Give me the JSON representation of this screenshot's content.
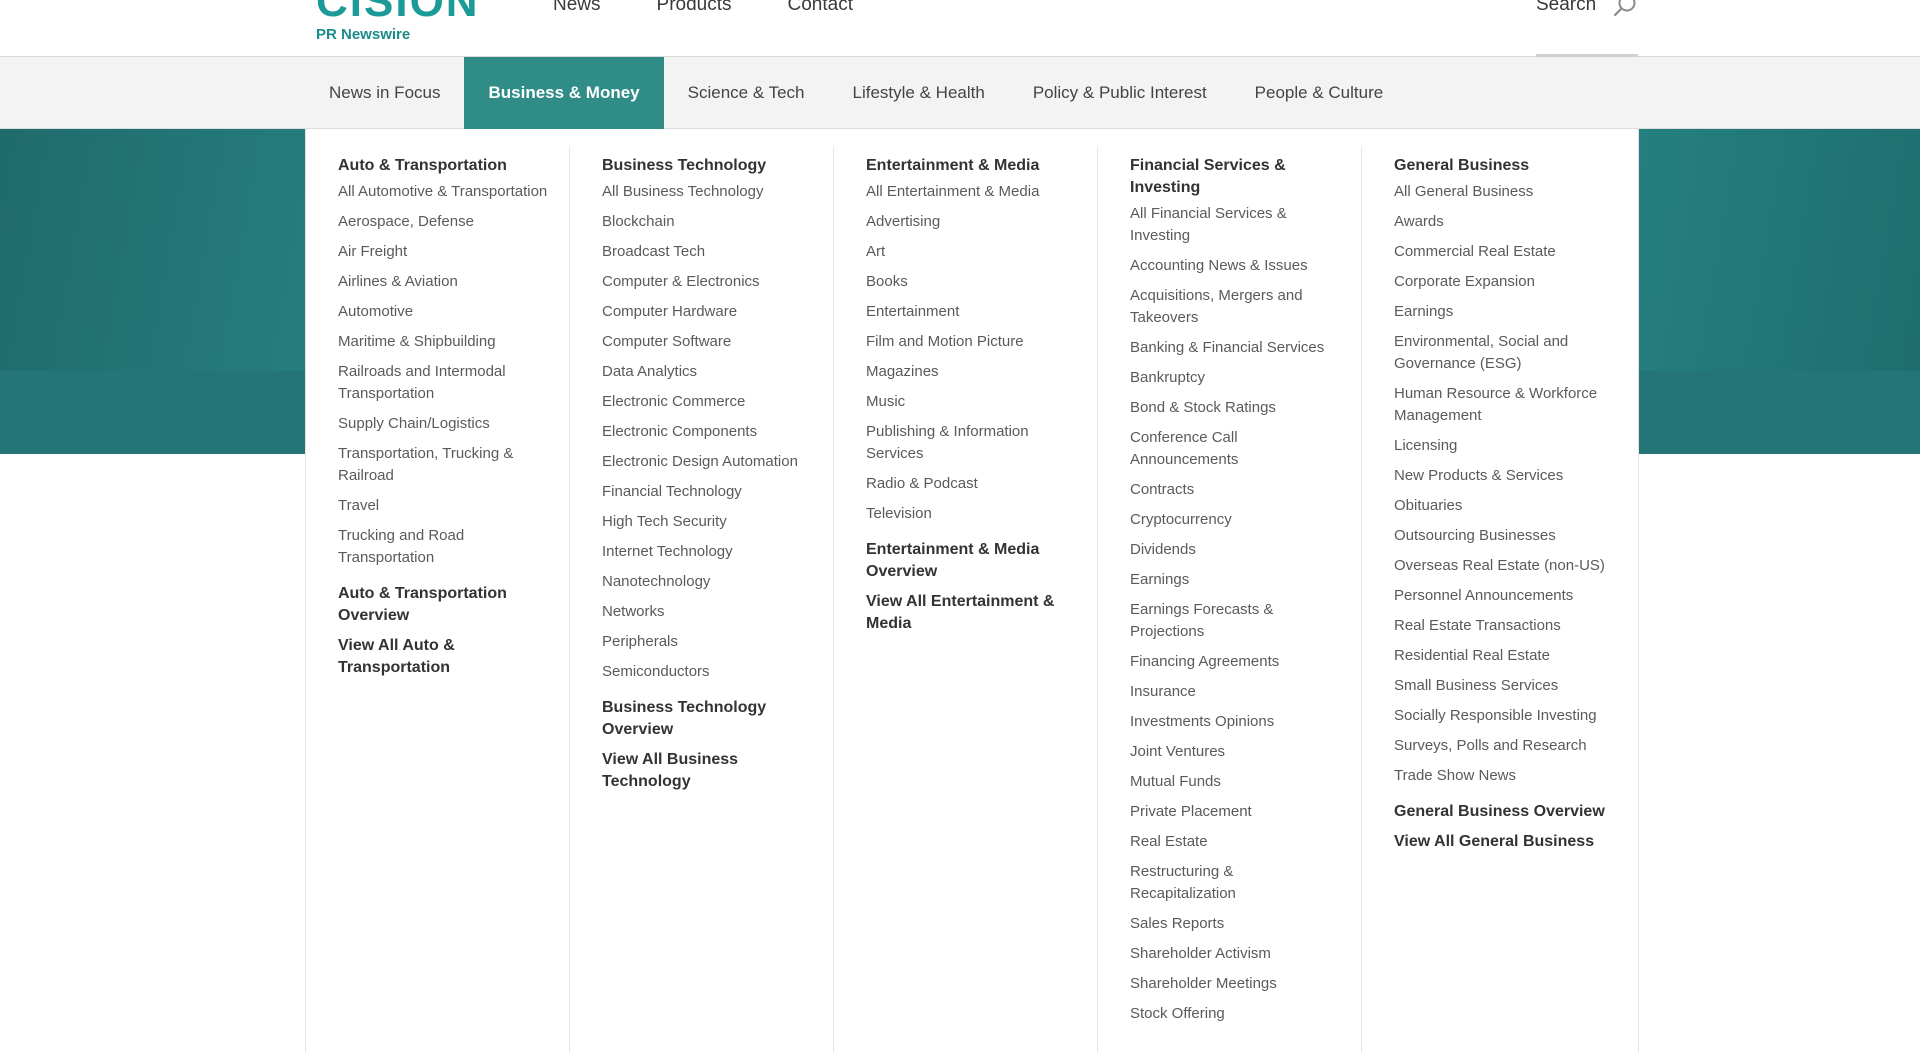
{
  "brand": {
    "mark": "CISION",
    "sub": "PR Newswire"
  },
  "topnav": [
    "News",
    "Products",
    "Contact"
  ],
  "search": {
    "label": "Search"
  },
  "subnav": {
    "items": [
      "News in Focus",
      "Business & Money",
      "Science & Tech",
      "Lifestyle & Health",
      "Policy & Public Interest",
      "People & Culture"
    ],
    "active": "Business & Money"
  },
  "columns": [
    {
      "heading": "Auto & Transportation",
      "items": [
        "All Automotive & Transportation",
        "Aerospace, Defense",
        "Air Freight",
        "Airlines & Aviation",
        "Automotive",
        "Maritime & Shipbuilding",
        "Railroads and Intermodal Transportation",
        "Supply Chain/Logistics",
        "Transportation, Trucking & Railroad",
        "Travel",
        "Trucking and Road Transportation"
      ],
      "overview": "Auto & Transportation Overview",
      "view_all": "View All Auto & Transportation"
    },
    {
      "heading": "Business Technology",
      "items": [
        "All Business Technology",
        "Blockchain",
        "Broadcast Tech",
        "Computer & Electronics",
        "Computer Hardware",
        "Computer Software",
        "Data Analytics",
        "Electronic Commerce",
        "Electronic Components",
        "Electronic Design Automation",
        "Financial Technology",
        "High Tech Security",
        "Internet Technology",
        "Nanotechnology",
        "Networks",
        "Peripherals",
        "Semiconductors"
      ],
      "overview": "Business Technology Overview",
      "view_all": "View All Business Technology"
    },
    {
      "heading": "Entertainment & Media",
      "items": [
        "All Entertainment & Media",
        "Advertising",
        "Art",
        "Books",
        "Entertainment",
        "Film and Motion Picture",
        "Magazines",
        "Music",
        "Publishing & Information Services",
        "Radio & Podcast",
        "Television"
      ],
      "overview": "Entertainment & Media Overview",
      "view_all": "View All Entertainment & Media"
    },
    {
      "heading": "Financial Services & Investing",
      "items": [
        "All Financial Services & Investing",
        "Accounting News & Issues",
        "Acquisitions, Mergers and Takeovers",
        "Banking & Financial Services",
        "Bankruptcy",
        "Bond & Stock Ratings",
        "Conference Call Announcements",
        "Contracts",
        "Cryptocurrency",
        "Dividends",
        "Earnings",
        "Earnings Forecasts & Projections",
        "Financing Agreements",
        "Insurance",
        "Investments Opinions",
        "Joint Ventures",
        "Mutual Funds",
        "Private Placement",
        "Real Estate",
        "Restructuring & Recapitalization",
        "Sales Reports",
        "Shareholder Activism",
        "Shareholder Meetings",
        "Stock Offering"
      ],
      "overview": "",
      "view_all": ""
    },
    {
      "heading": "General Business",
      "items": [
        "All General Business",
        "Awards",
        "Commercial Real Estate",
        "Corporate Expansion",
        "Earnings",
        "Environmental, Social and Governance (ESG)",
        "Human Resource & Workforce Management",
        "Licensing",
        "New Products & Services",
        "Obituaries",
        "Outsourcing Businesses",
        "Overseas Real Estate (non-US)",
        "Personnel Announcements",
        "Real Estate Transactions",
        "Residential Real Estate",
        "Small Business Services",
        "Socially Responsible Investing",
        "Surveys, Polls and Research",
        "Trade Show News"
      ],
      "overview": "General Business Overview",
      "view_all": "View All General Business"
    }
  ]
}
